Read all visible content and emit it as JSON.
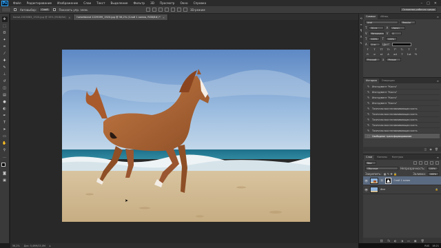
{
  "menubar": {
    "logo": "Ps",
    "items": [
      "Файл",
      "Редактирование",
      "Изображение",
      "Слои",
      "Текст",
      "Выделение",
      "Фильтр",
      "3D",
      "Просмотр",
      "Окно",
      "Справка"
    ],
    "window_controls": [
      "–",
      "□",
      "✕"
    ]
  },
  "options": {
    "autoselect_label": "Автовыбор:",
    "autoselect_value": "Слой",
    "show_controls_label": "Показать упр. элем.",
    "mode_3d": "3D-режим:",
    "workspace": "Основная рабочая среда"
  },
  "tabs": [
    {
      "label": "horse-2003883_1920.jpg @ 33% (RGB/8#)"
    },
    {
      "label": "horseIsland 2229099_1920.jpg @ 56,2% (Слой 1 копия, RGB/8#) *"
    }
  ],
  "status": {
    "zoom": "56,2%",
    "doc": "Док: 5,49M/15,0M"
  },
  "taskbar": {
    "lang": "RUS",
    "time": "18:21"
  },
  "character_panel": {
    "tabs": [
      "Символ",
      "Абзац"
    ],
    "font": "Arial",
    "style": "Regular",
    "size": "30 пт",
    "leading": "(Авто)",
    "kerning": "Метрические",
    "tracking": "0",
    "scale_v": "100%",
    "scale_h": "100%",
    "baseline": "0 пт",
    "color_label": "Цвет:",
    "styles": [
      "T",
      "T",
      "TT",
      "Tt",
      "T¹",
      "T₁",
      "T",
      "T"
    ],
    "opentype": [
      "fi",
      "σ",
      "st",
      "A",
      "ad",
      "T",
      "1st",
      "½"
    ],
    "language": "Русский",
    "aa_prefix": "a",
    "aa": "Резкое"
  },
  "history_panel": {
    "tabs": [
      "История",
      "Операции"
    ],
    "items": [
      {
        "icon": "✎",
        "label": "Инструмент \"Кисть\""
      },
      {
        "icon": "✎",
        "label": "Инструмент \"Кисть\""
      },
      {
        "icon": "✎",
        "label": "Инструмент \"Кисть\""
      },
      {
        "icon": "✎",
        "label": "Инструмент \"Кисть\""
      },
      {
        "icon": "✎",
        "label": "Точечная восстанавливающая кисть"
      },
      {
        "icon": "✎",
        "label": "Точечная восстанавливающая кисть"
      },
      {
        "icon": "✎",
        "label": "Точечная восстанавливающая кисть"
      },
      {
        "icon": "✎",
        "label": "Точечная восстанавливающая кисть"
      },
      {
        "icon": "✎",
        "label": "Точечная восстанавливающая кисть"
      },
      {
        "icon": "⬚",
        "label": "Свободное трансформирование"
      }
    ]
  },
  "layers_panel": {
    "tabs": [
      "Слои",
      "Каналы",
      "Контуры"
    ],
    "filter_kind": "Вид",
    "blend_mode": "Обычные",
    "opacity_label": "Непрозрачность:",
    "opacity": "100%",
    "lock_label": "Закрепить:",
    "fill_label": "Заливка:",
    "fill": "100%",
    "layers": [
      {
        "name": "Слой 1 копия",
        "selected": true,
        "has_mask": true
      },
      {
        "name": "Фон",
        "selected": false,
        "has_mask": false
      }
    ],
    "footer_icons": [
      "⛓",
      "fx",
      "◐",
      "◑",
      "▭",
      "▣",
      "🗑"
    ]
  }
}
